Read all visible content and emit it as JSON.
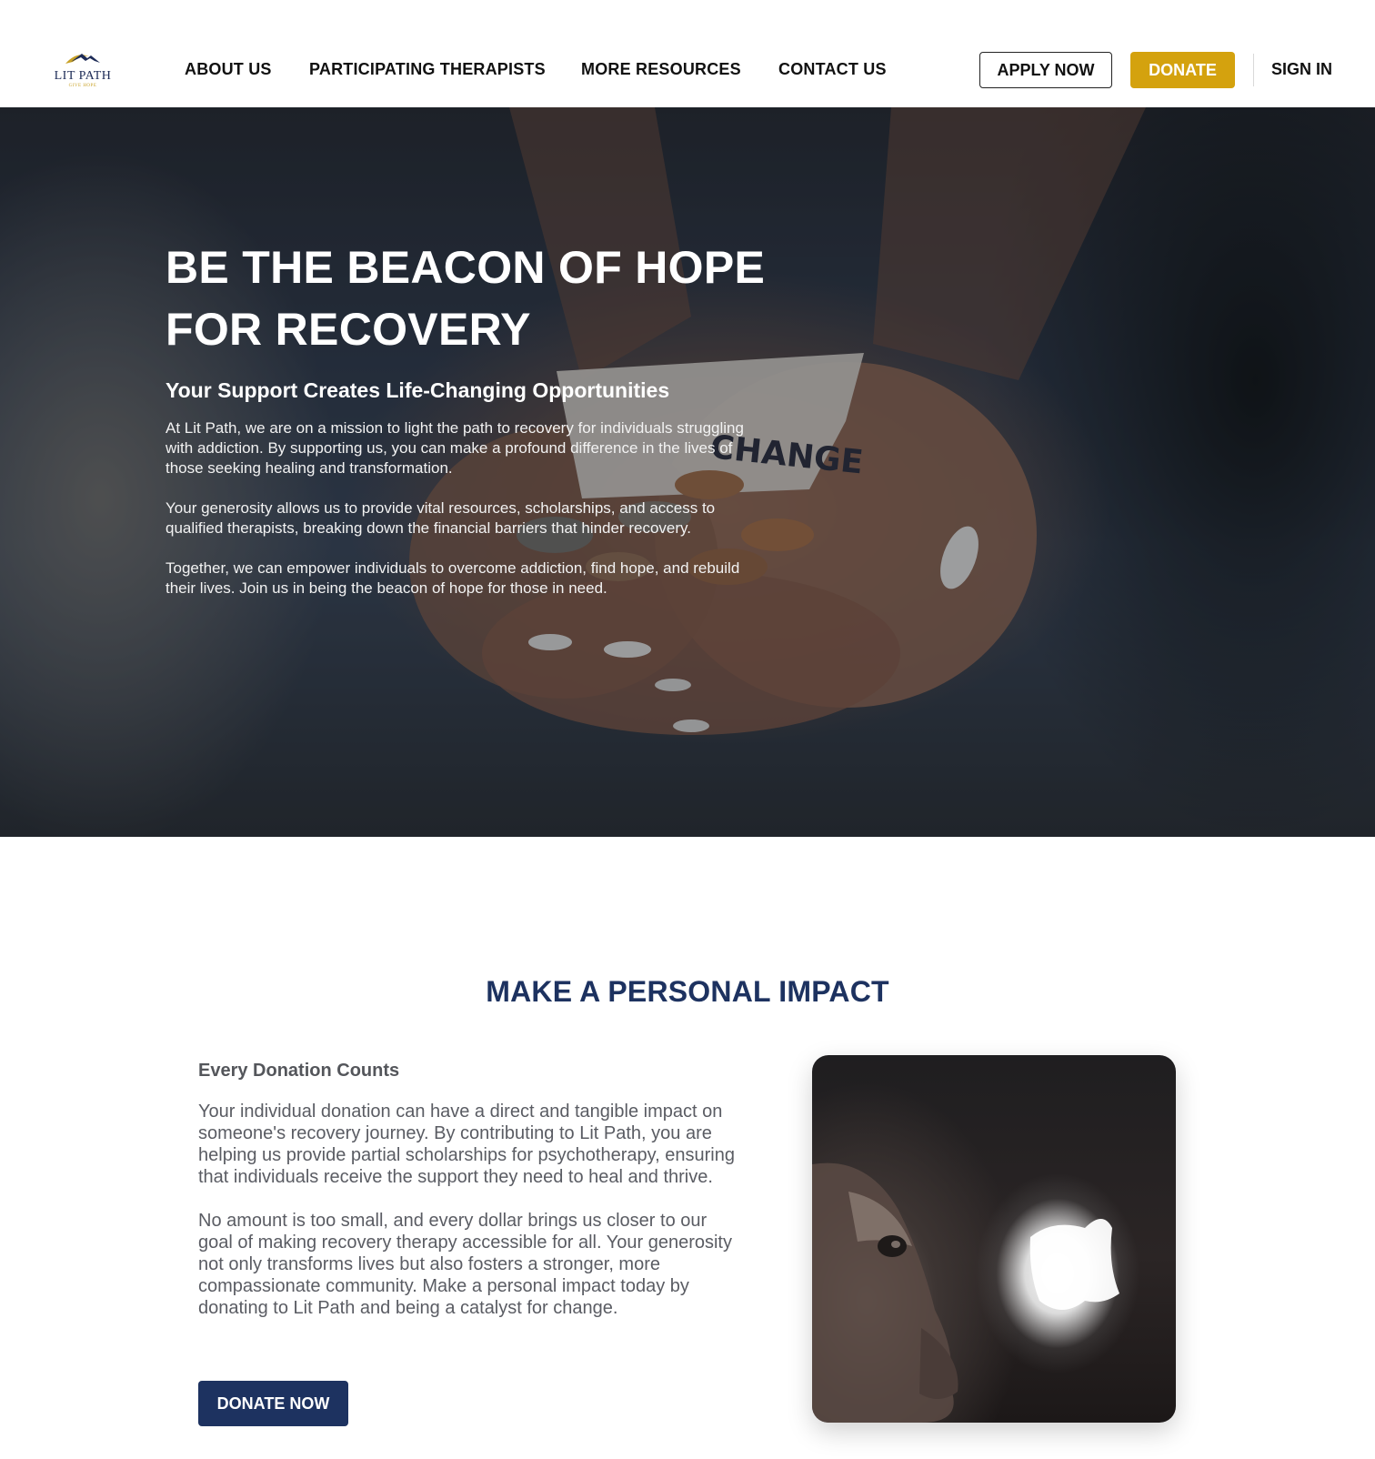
{
  "brand": {
    "name": "LIT PATH",
    "tagline": "GIVE HOPE",
    "colors": {
      "navy": "#1d3260",
      "gold": "#d4a20e"
    }
  },
  "nav": {
    "items": [
      {
        "label": "ABOUT US"
      },
      {
        "label": "PARTICIPATING THERAPISTS"
      },
      {
        "label": "MORE RESOURCES"
      },
      {
        "label": "CONTACT US"
      }
    ],
    "apply_label": "APPLY NOW",
    "donate_label": "DONATE",
    "signin_label": "SIGN IN"
  },
  "hero": {
    "title_line1": "BE THE BEACON OF HOPE",
    "title_line2": "FOR RECOVERY",
    "subtitle": "Your Support Creates Life-Changing Opportunities",
    "paragraphs": [
      "At Lit Path, we are on a mission to light the path to recovery for individuals struggling with addiction. By supporting us, you can make a profound difference in the lives of those seeking healing and transformation.",
      "Your generosity allows us to provide vital resources, scholarships, and access to qualified therapists, breaking down the financial barriers that hinder recovery.",
      "Together, we can empower individuals to overcome addiction, find hope, and rebuild their lives. Join us in being the beacon of hope for those in need."
    ],
    "image_note_text": "CHANGE"
  },
  "impact": {
    "heading": "MAKE A PERSONAL IMPACT",
    "subheading": "Every Donation Counts",
    "paragraphs": [
      "Your individual donation can have a direct and tangible impact on someone's recovery journey. By contributing to Lit Path, you are helping us provide partial scholarships for psychotherapy, ensuring that individuals receive the support they need to heal and thrive.",
      "No amount is too small, and every dollar brings us closer to our goal of making recovery therapy accessible for all. Your generosity not only transforms lives but also fosters a stronger, more compassionate community. Make a personal impact today by donating to Lit Path and being a catalyst for change."
    ],
    "button_label": "DONATE NOW"
  }
}
